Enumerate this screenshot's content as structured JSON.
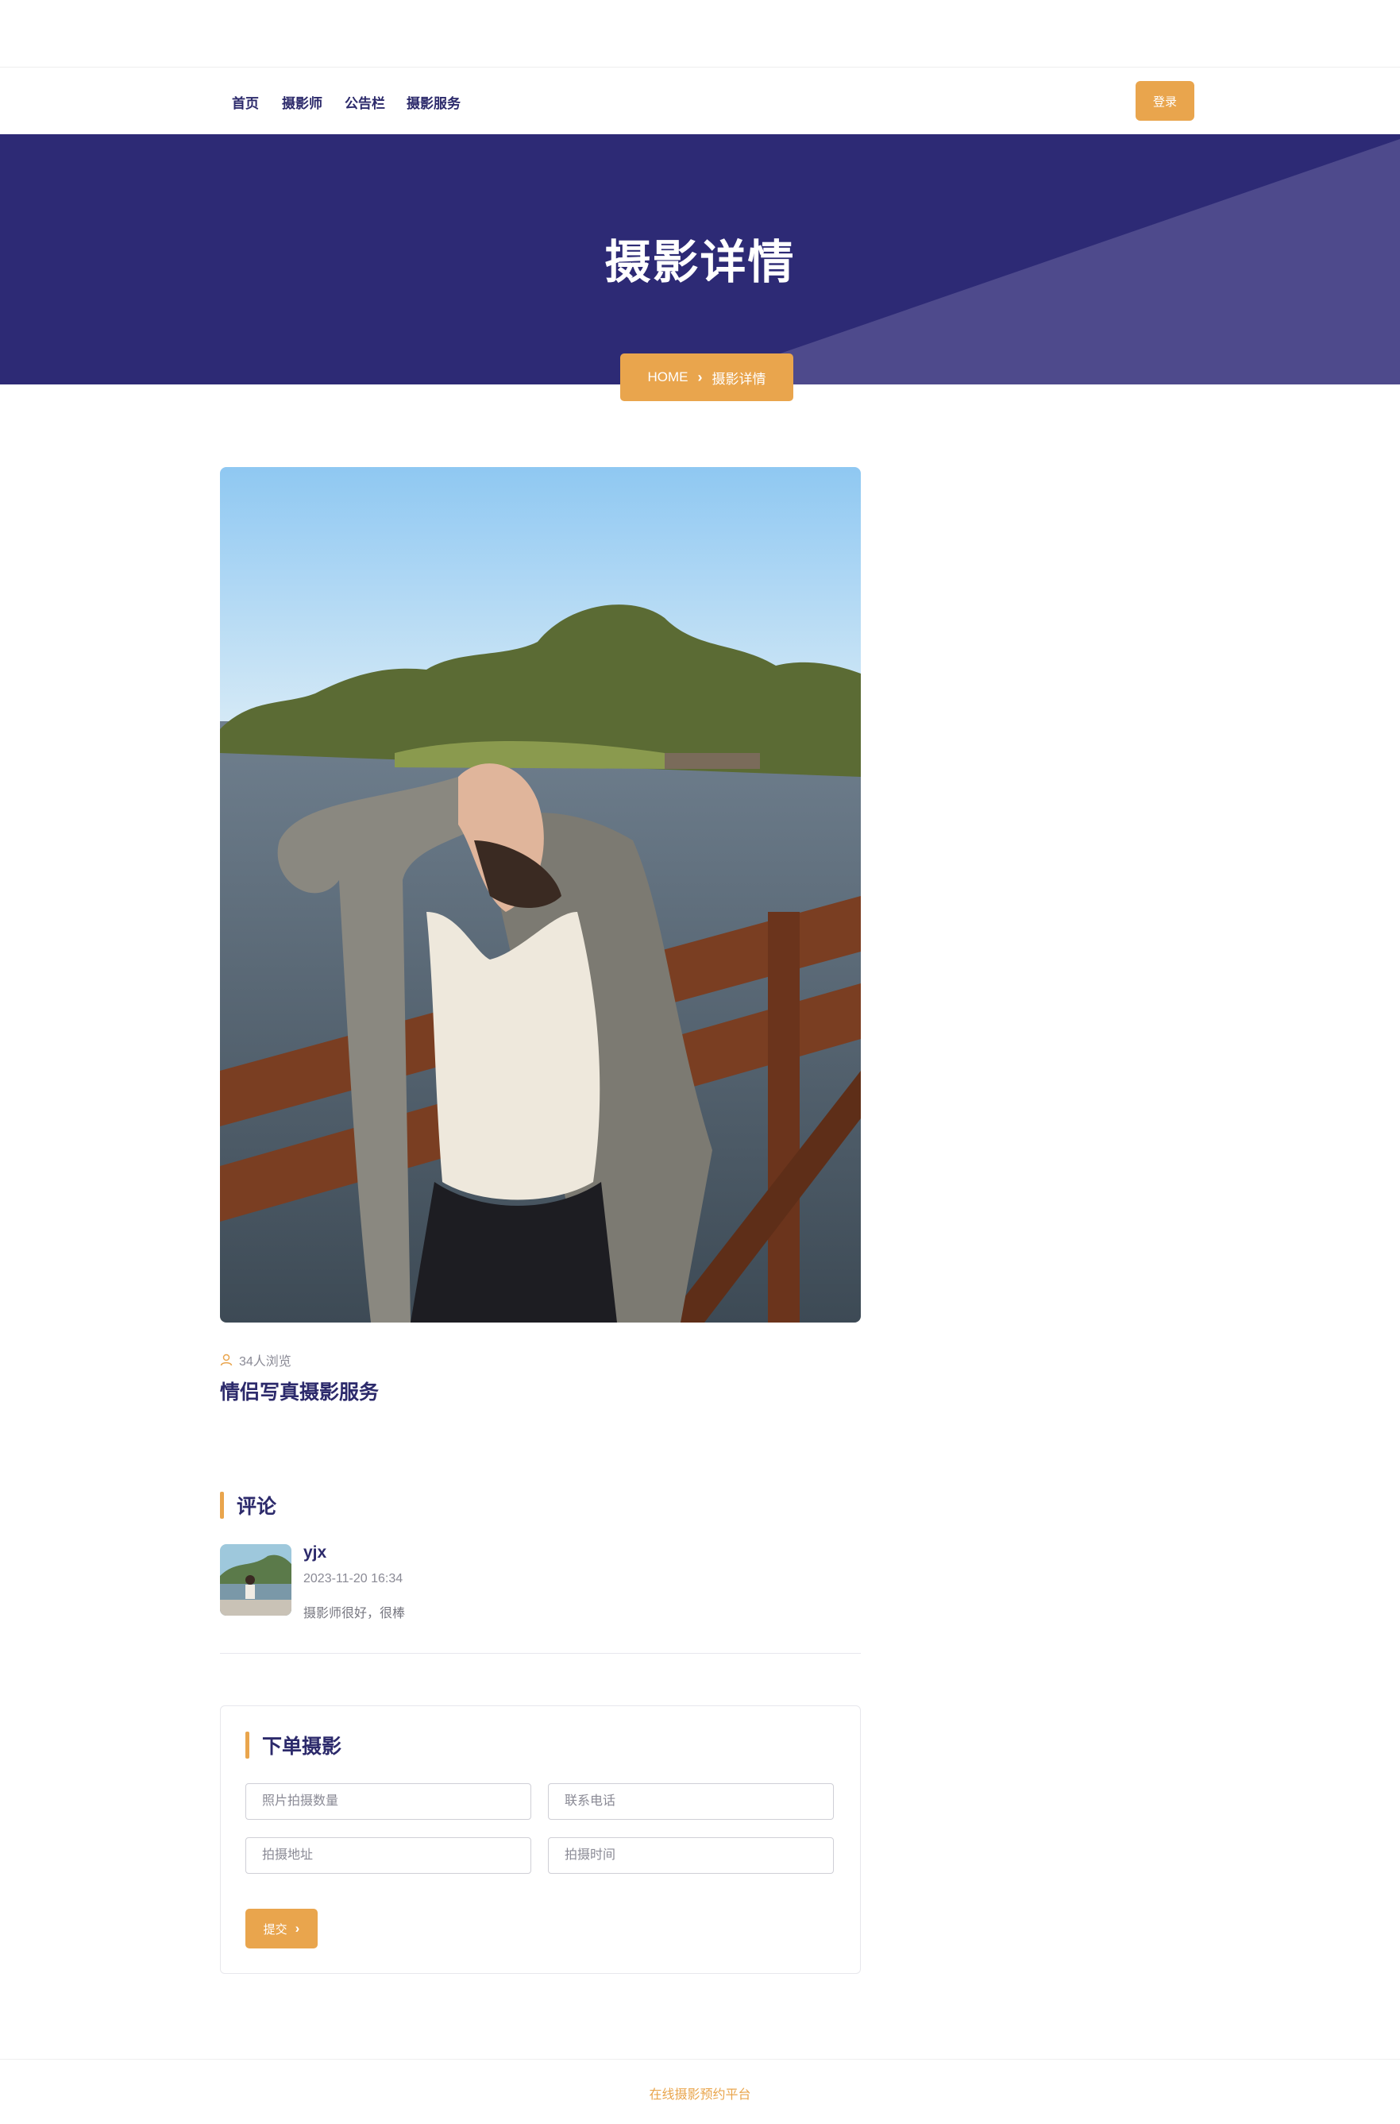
{
  "nav": {
    "items": [
      {
        "label": "首页"
      },
      {
        "label": "摄影师"
      },
      {
        "label": "公告栏"
      },
      {
        "label": "摄影服务"
      }
    ],
    "login_label": "登录"
  },
  "hero": {
    "title": "摄影详情",
    "breadcrumb_home": "HOME",
    "breadcrumb_current": "摄影详情"
  },
  "service": {
    "views": "34人浏览",
    "title": "情侣写真摄影服务"
  },
  "comments": {
    "heading": "评论",
    "items": [
      {
        "user": "yjx",
        "date": "2023-11-20 16:34",
        "text": "摄影师很好，很棒"
      }
    ]
  },
  "order": {
    "heading": "下单摄影",
    "fields": [
      {
        "placeholder": "照片拍摄数量"
      },
      {
        "placeholder": "联系电话"
      },
      {
        "placeholder": "拍摄地址"
      },
      {
        "placeholder": "拍摄时间"
      }
    ],
    "submit_label": "提交"
  },
  "footer": {
    "text": "在线摄影预约平台"
  },
  "colors": {
    "navy": "#2d2a75",
    "navy_light": "#4e4a8c",
    "accent": "#e9a54d",
    "title": "#2c2a6b"
  }
}
